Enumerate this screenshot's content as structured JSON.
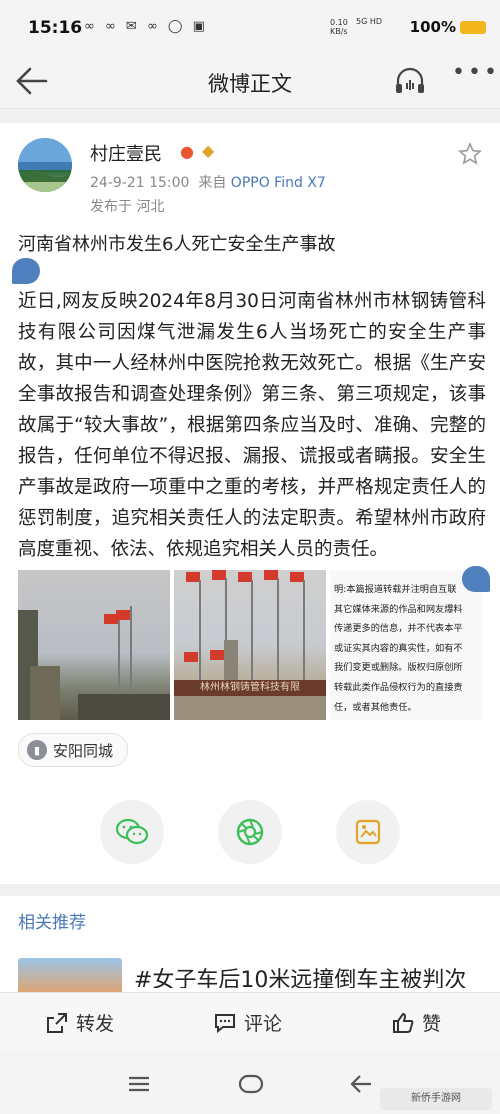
{
  "status_bar": {
    "time": "15:16",
    "notif_icons": "∞ ∞ ✉ ∞ ◯ ▣",
    "net_speed": "0.10\nKB/s",
    "signal": "5G HD",
    "battery_pct": "100%"
  },
  "nav": {
    "title": "微博正文"
  },
  "post": {
    "author": "村庄壹民",
    "time": "24-9-21 15:00",
    "from_prefix": "来自",
    "device": "OPPO Find X7",
    "location": "发布于 河北",
    "title": "河南省林州市发生6人死亡安全生产事故",
    "body": "近日,网友反映2024年8月30日河南省林州市林钢铸管科技有限公司因煤气泄漏发生6人当场死亡的安全生产事故，其中一人经林州中医院抢救无效死亡。根据《生产安全事故报告和调查处理条例》第三条、第三项规定，该事故属于“较大事故”，根据第四条应当及时、准确、完整的报告，任何单位不得迟报、漏报、谎报或者瞒报。安全生产事故是政府一项重中之重的考核，并严格规定责任人的惩罚制度，追究相关责任人的法定职责。希望林州市政府高度重视、依法、依规追究相关人员的责任。",
    "image2_banner": "林州林钢铸管科技有限",
    "image3_lines": [
      "明:本篇报道转载并注明自互联",
      "其它媒体来源的作品和网友爆料",
      "传递更多的信息，并不代表本平",
      "或证实其内容的真实性，如有不",
      "我们变更或删除。版权归原创所",
      "转载此类作品侵权行为的直接责",
      "任，或者其他责任。"
    ],
    "location_chip": "安阳同城"
  },
  "related": {
    "heading": "相关推荐",
    "first_title": "#女子车后10米远撞倒车主被判次"
  },
  "actions": {
    "repost": "转发",
    "comment": "评论",
    "like": "赞"
  },
  "watermark": "新侨手游网"
}
